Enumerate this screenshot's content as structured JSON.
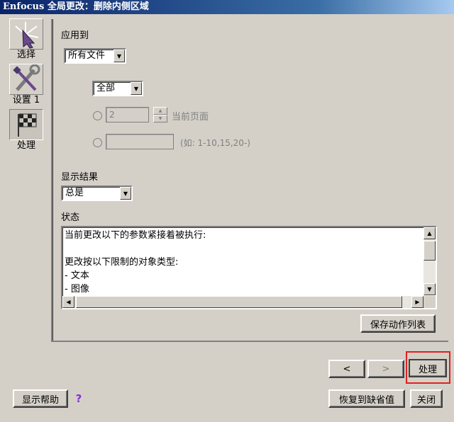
{
  "window": {
    "title_brand": "Enfocus",
    "title_rest": "全局更改：删除内侧区域"
  },
  "sidebar": {
    "items": [
      {
        "label": "选择",
        "icon": "cursor-star-icon"
      },
      {
        "label": "设置 1",
        "icon": "wrench-screwdriver-icon"
      },
      {
        "label": "处理",
        "icon": "checkered-flag-icon"
      }
    ]
  },
  "apply_to": {
    "label": "应用到",
    "value": "所有文件",
    "page_scope": "全部",
    "current_page_value": "2",
    "current_page_label": "当前页面",
    "range_value": "",
    "range_hint": "(如: 1-10,15,20-)"
  },
  "display_results": {
    "label": "显示结果",
    "value": "总是"
  },
  "status": {
    "label": "状态",
    "lines": [
      "当前更改以下的参数紧接着被执行:",
      "",
      "更改按以下限制的对象类型:",
      "- 文本",
      "- 图像"
    ]
  },
  "buttons": {
    "save_actions": "保存动作列表",
    "prev": "<",
    "next": ">",
    "process": "处理",
    "show_help": "显示帮助",
    "help_icon": "?",
    "restore_defaults": "恢复到缺省值",
    "close": "关闭"
  },
  "colors": {
    "titlebar": "#0a246a",
    "highlight": "#e02020",
    "face": "#d4d0c8"
  }
}
